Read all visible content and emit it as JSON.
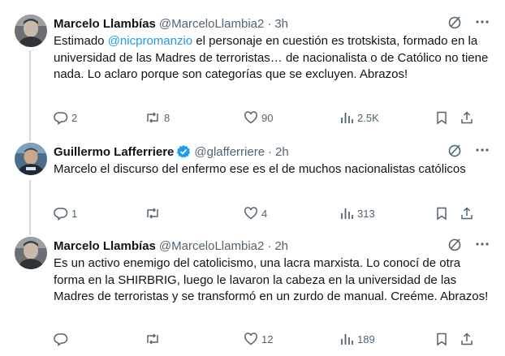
{
  "tweets": [
    {
      "name": "Marcelo Llambías",
      "handle": "@MarceloLlambia2",
      "time": "3h",
      "verified": false,
      "text_parts": {
        "before": "Estimado ",
        "mention": "@nicpromanzio",
        "after": " el personaje en cuestión es trotskista, formado en la universidad de las Madres de terroristas… de nacionalista o de Católico no tiene nada. Lo aclaro porque son categorías que se excluyen. Abrazos!"
      },
      "replies": "2",
      "reposts": "8",
      "likes": "90",
      "views": "2.5K"
    },
    {
      "name": "Guillermo Lafferriere",
      "handle": "@glafferriere",
      "time": "2h",
      "verified": true,
      "text": "Marcelo el discurso del enfermo ese es el de muchos nacionalistas católicos",
      "replies": "1",
      "reposts": "",
      "likes": "4",
      "views": "313"
    },
    {
      "name": "Marcelo Llambías",
      "handle": "@MarceloLlambia2",
      "time": "2h",
      "verified": false,
      "text": "Es un activo enemigo del catolicismo, una lacra marxista. Lo conocí de otra forma en la SHIRBRIG, luego le lavaron la cabeza en la universidad de las Madres de terroristas y se transformó en un zurdo de manual. Creéme. Abrazos!",
      "replies": "",
      "reposts": "",
      "likes": "12",
      "views": "189"
    }
  ],
  "separator": "·",
  "colors": {
    "accent": "#1d9bf0",
    "muted": "#536471",
    "text": "#0f1419",
    "thread_line": "#cfd9de"
  },
  "icons": [
    "grok-icon",
    "more-icon",
    "reply-icon",
    "repost-icon",
    "like-icon",
    "views-icon",
    "bookmark-icon",
    "share-icon",
    "verified-badge-icon"
  ]
}
